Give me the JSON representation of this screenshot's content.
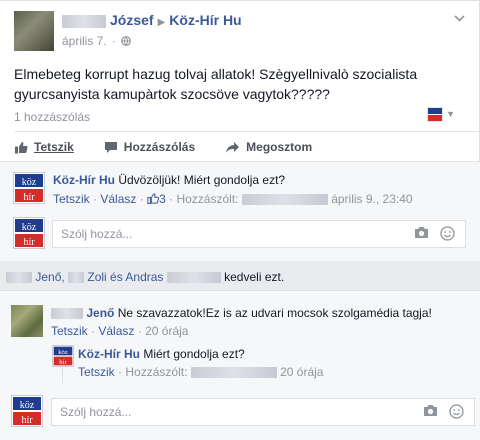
{
  "post": {
    "author_first": "József",
    "page": "Köz-Hír Hu",
    "date": "április 7.",
    "text": "Elmebeteg korrupt hazug tolvaj allatok! Szègyellnivalò szocialista gyurcsanyista kamupàrtok szocsöve vagytok?????",
    "comment_count": "1 hozzászólás"
  },
  "actions": {
    "like": "Tetszik",
    "comment": "Hozzászólás",
    "share": "Megosztom"
  },
  "comment1": {
    "author": "Köz-Hír Hu",
    "text": "Üdvözöljük! Miért gondolja ezt?",
    "like": "Tetszik",
    "dot1": "·",
    "reply": "Válasz",
    "dot2": "·",
    "like_count": "3",
    "dot3": "·",
    "posted_by": "Hozzászólt:",
    "timestamp": "április 9., 23:40"
  },
  "reply_placeholder": "Szólj hozzá...",
  "likes_line": {
    "name1": "Jenő,",
    "name2": "Zoli és Andras",
    "suffix": "kedveli ezt."
  },
  "comment2": {
    "author": "Jenő",
    "text": "Ne szavazzatok!Ez is az udvari mocsok szolgamédia tagja!",
    "like": "Tetszik",
    "dot1": "·",
    "reply": "Válasz",
    "dot2": "·",
    "time": "20 órája"
  },
  "reply1": {
    "author": "Köz-Hír Hu",
    "text": "Miért gondolja ezt?",
    "like": "Tetszik",
    "dot1": "·",
    "posted_by": "Hozzászólt:",
    "time": "20 órája"
  },
  "logo_text": {
    "top": "köz",
    "bottom": "hír"
  },
  "colors": {
    "link": "#3b5998",
    "logo_blue": "#1f3c8f",
    "logo_red": "#d42b2b",
    "muted": "#90949c"
  }
}
